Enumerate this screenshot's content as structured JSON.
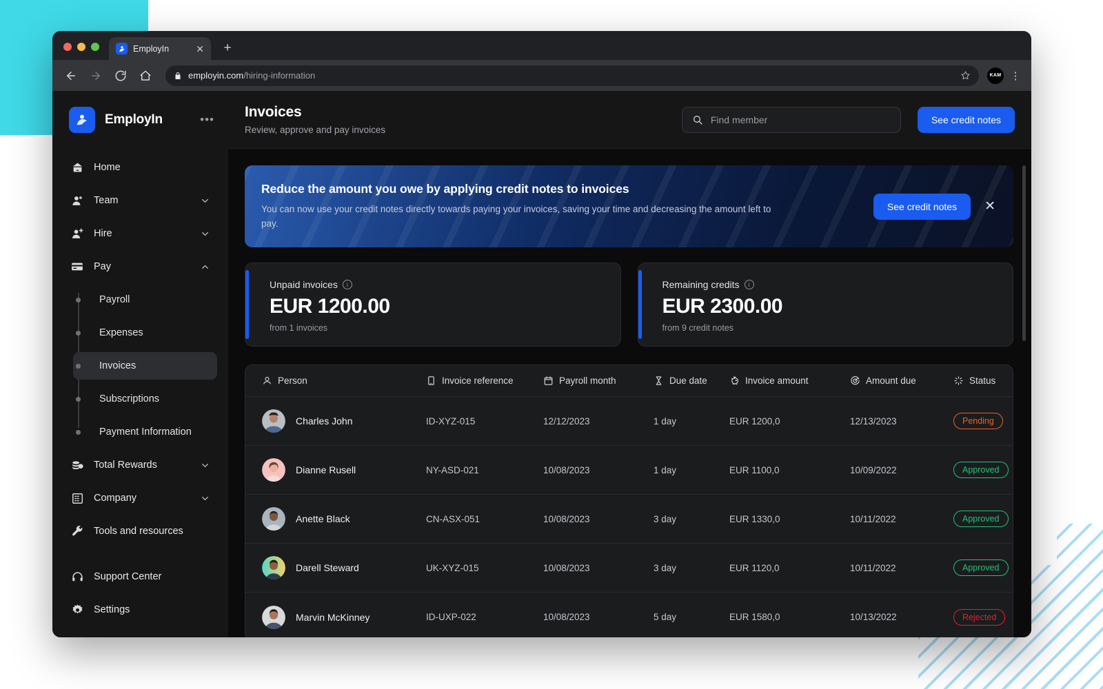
{
  "browser": {
    "tab_title": "EmployIn",
    "tab_close_icon": "close-icon",
    "new_tab_icon": "plus-icon",
    "back_icon": "arrow-left-icon",
    "forward_icon": "arrow-right-icon",
    "reload_icon": "reload-icon",
    "home_icon": "home-icon",
    "lock_icon": "lock-icon",
    "url_domain": "employin.com",
    "url_path": "/hiring-information",
    "star_icon": "star-icon",
    "profile_initials": "KAM",
    "menu_icon": "kebab-menu-icon"
  },
  "sidebar": {
    "brand": "EmployIn",
    "more_label": "•••",
    "items": [
      {
        "label": "Home",
        "icon": "home-icon",
        "expandable": false,
        "chevron": ""
      },
      {
        "label": "Team",
        "icon": "people-icon",
        "expandable": true,
        "chevron": "down"
      },
      {
        "label": "Hire",
        "icon": "user-plus-icon",
        "expandable": true,
        "chevron": "down"
      },
      {
        "label": "Pay",
        "icon": "card-icon",
        "expandable": true,
        "chevron": "up"
      }
    ],
    "sub_items": [
      {
        "label": "Payroll",
        "active": false
      },
      {
        "label": "Expenses",
        "active": false
      },
      {
        "label": "Invoices",
        "active": true
      },
      {
        "label": "Subscriptions",
        "active": false
      },
      {
        "label": "Payment Information",
        "active": false
      }
    ],
    "items_after": [
      {
        "label": "Total Rewards",
        "icon": "coins-icon",
        "expandable": true,
        "chevron": "down"
      },
      {
        "label": "Company",
        "icon": "building-icon",
        "expandable": true,
        "chevron": "down"
      },
      {
        "label": "Tools and resources",
        "icon": "wrench-icon",
        "expandable": false,
        "chevron": ""
      }
    ],
    "items_footer": [
      {
        "label": "Support Center",
        "icon": "headset-icon"
      },
      {
        "label": "Settings",
        "icon": "gear-icon"
      }
    ]
  },
  "header": {
    "title": "Invoices",
    "subtitle": "Review, approve and pay invoices",
    "search_placeholder": "Find member",
    "search_value": "",
    "search_icon": "search-icon",
    "credit_notes_button": "See credit notes"
  },
  "banner": {
    "heading": "Reduce the amount you owe by applying credit notes to invoices",
    "body": "You can now use your credit notes directly towards paying your invoices, saving your time and decreasing the amount left to pay.",
    "button": "See credit notes",
    "close_icon": "close-icon"
  },
  "stats": [
    {
      "label": "Unpaid invoices",
      "value": "EUR 1200.00",
      "sub": "from 1 invoices",
      "info_icon": "info-icon",
      "accent": "#1a5cf0"
    },
    {
      "label": "Remaining credits",
      "value": "EUR 2300.00",
      "sub": "from 9 credit notes",
      "info_icon": "info-icon",
      "accent": "#1a5cf0"
    }
  ],
  "table": {
    "columns": [
      {
        "label": "Person",
        "icon": "person-icon"
      },
      {
        "label": "Invoice reference",
        "icon": "document-icon"
      },
      {
        "label": "Payroll month",
        "icon": "calendar-icon"
      },
      {
        "label": "Due date",
        "icon": "hourglass-icon"
      },
      {
        "label": "Invoice amount",
        "icon": "piggy-bank-icon"
      },
      {
        "label": "Amount due",
        "icon": "target-icon"
      },
      {
        "label": "Status",
        "icon": "sparkle-icon"
      }
    ],
    "rows": [
      {
        "person": "Charles John",
        "avatar_colors": [
          "#b9bec4",
          "#4b6a8d"
        ],
        "reference": "ID-XYZ-015",
        "payroll_month": "12/12/2023",
        "due_date": "1 day",
        "invoice_amount": "EUR 1200,0",
        "amount_due": "12/13/2023",
        "status": "Pending",
        "status_kind": "pending"
      },
      {
        "person": "Dianne Rusell",
        "avatar_colors": [
          "#f6c2c0",
          "#e5a39c"
        ],
        "reference": "NY-ASD-021",
        "payroll_month": "10/08/2023",
        "due_date": "1 day",
        "invoice_amount": "EUR 1100,0",
        "amount_due": "10/09/2022",
        "status": "Approved",
        "status_kind": "approved"
      },
      {
        "person": "Anette Black",
        "avatar_colors": [
          "#a9b4bd",
          "#8d9aa3"
        ],
        "reference": "CN-ASX-051",
        "payroll_month": "10/08/2023",
        "due_date": "3 day",
        "invoice_amount": "EUR 1330,0",
        "amount_due": "10/11/2022",
        "status": "Approved",
        "status_kind": "approved"
      },
      {
        "person": "Darell Steward",
        "avatar_colors": [
          "#57d6c4",
          "#f3d06a"
        ],
        "reference": "UK-XYZ-015",
        "payroll_month": "10/08/2023",
        "due_date": "3 day",
        "invoice_amount": "EUR 1120,0",
        "amount_due": "10/11/2022",
        "status": "Approved",
        "status_kind": "approved"
      },
      {
        "person": "Marvin McKinney",
        "avatar_colors": [
          "#d8d9db",
          "#46536b"
        ],
        "reference": "ID-UXP-022",
        "payroll_month": "10/08/2023",
        "due_date": "5 day",
        "invoice_amount": "EUR 1580,0",
        "amount_due": "10/13/2022",
        "status": "Rejected",
        "status_kind": "rejected"
      }
    ]
  }
}
